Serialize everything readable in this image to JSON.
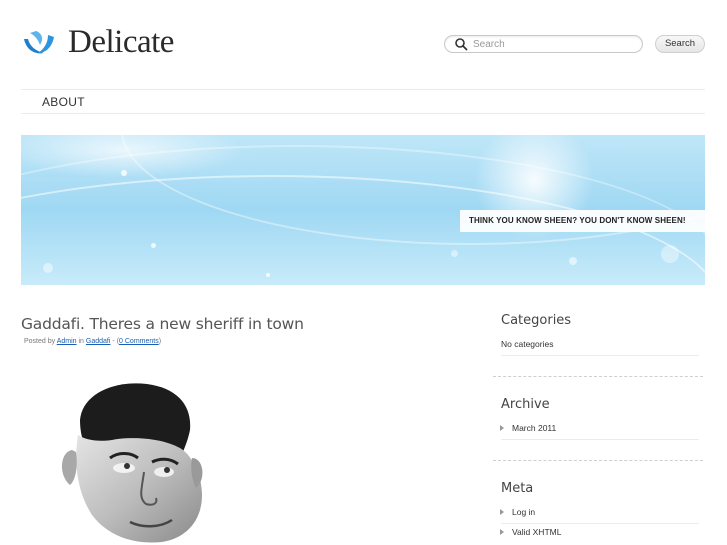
{
  "header": {
    "site_title": "Delicate",
    "search": {
      "placeholder": "Search"
    },
    "search_button_label": "Search"
  },
  "nav": {
    "items": [
      {
        "label": "ABOUT"
      }
    ]
  },
  "banner": {
    "caption": "THINK YOU KNOW SHEEN? YOU DON'T KNOW SHEEN!"
  },
  "post": {
    "title": "Gaddafi. Theres a new sheriff in town",
    "meta": {
      "posted_by_label": "Posted by",
      "author": "Admin",
      "in_label": "in",
      "category": "Gaddafi",
      "separator": "-",
      "comments_open": "(",
      "comments": "0 Comments",
      "comments_close": ")"
    }
  },
  "sidebar": {
    "categories": {
      "title": "Categories",
      "empty_text": "No categories"
    },
    "archive": {
      "title": "Archive",
      "items": [
        "March 2011"
      ]
    },
    "meta": {
      "title": "Meta",
      "items": [
        "Log in",
        "Valid XHTML"
      ]
    }
  },
  "colors": {
    "logo_blue": "#1e7fd0",
    "link": "#1a5fb4",
    "banner": "#9fd8f3"
  }
}
